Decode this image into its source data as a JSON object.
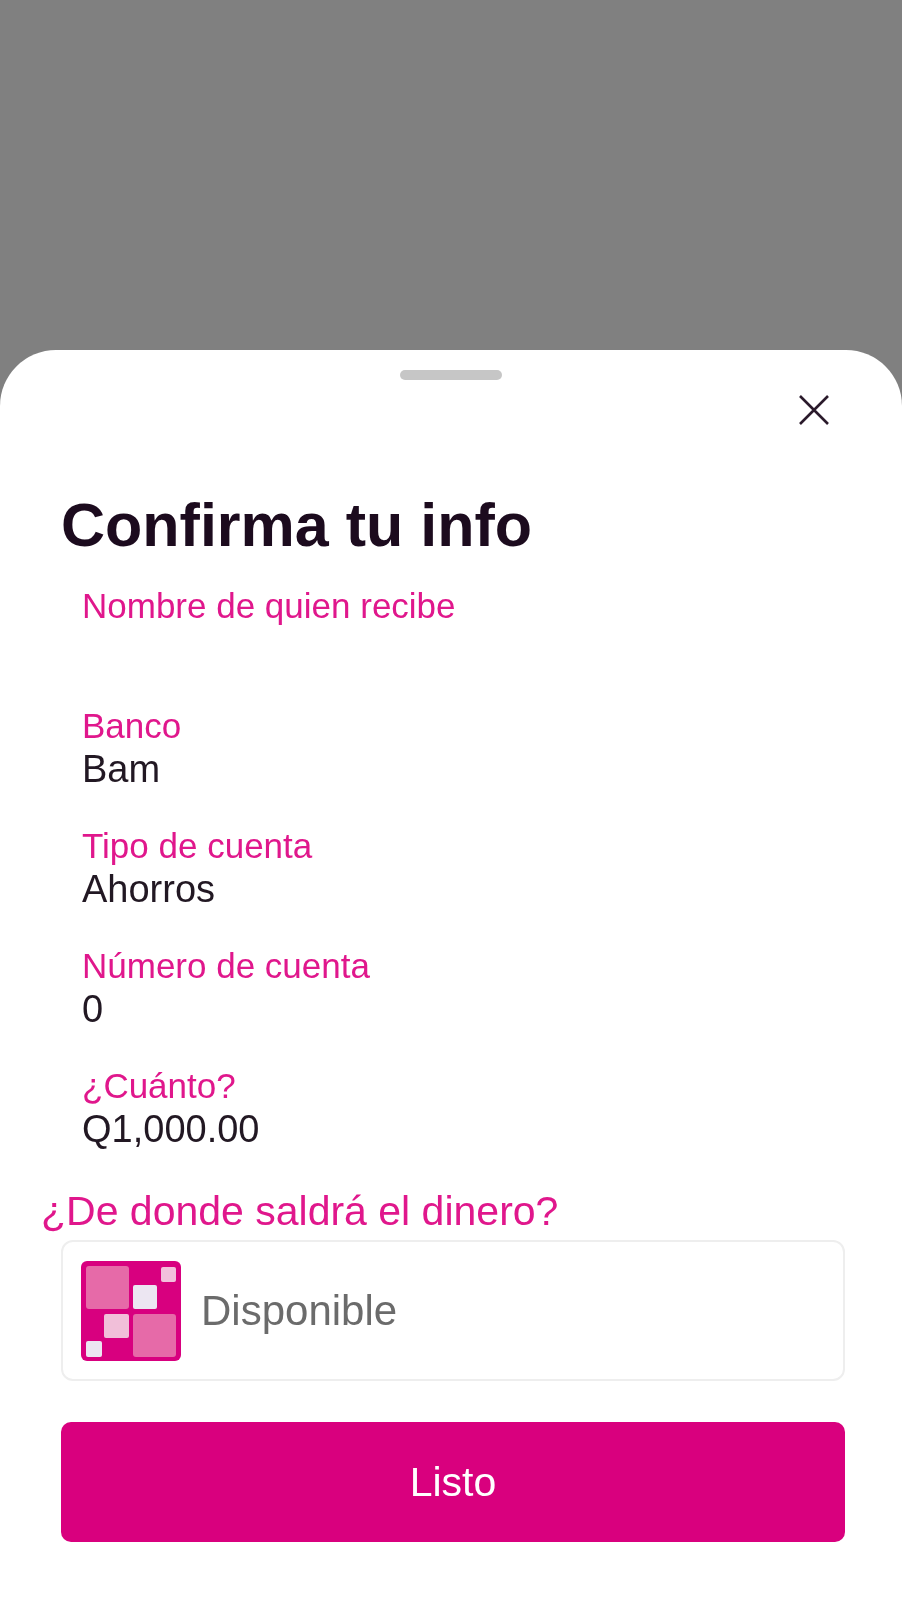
{
  "title": "Confirma tu info",
  "fields": [
    {
      "label": "Nombre de quien recibe"
    },
    {
      "label": "Banco",
      "value": "Bam"
    },
    {
      "label": "Tipo de cuenta",
      "value": "Ahorros"
    },
    {
      "label": "Número de cuenta",
      "value": "0"
    },
    {
      "label": "¿Cuánto?",
      "value": "Q1,000.00"
    }
  ],
  "funding_source": {
    "heading": "¿De donde saldrá el dinero?",
    "account": {
      "name": "Disponible"
    }
  },
  "button": {
    "label": "Listo"
  }
}
